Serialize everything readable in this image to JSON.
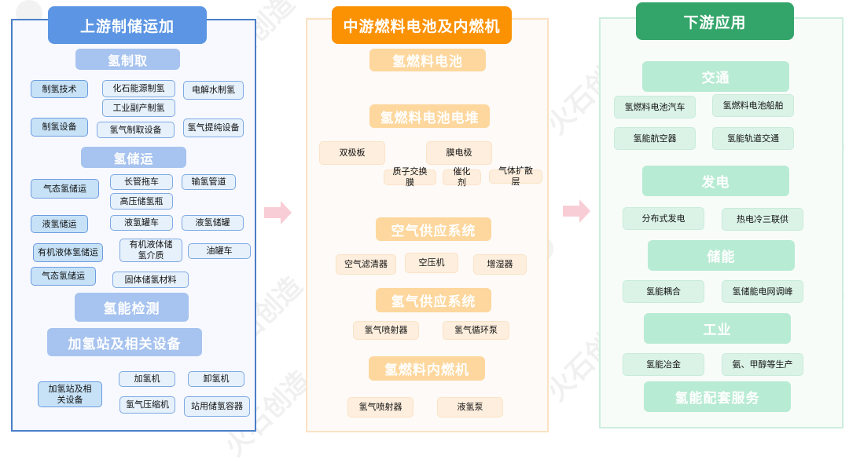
{
  "upstream": {
    "title": "上游制储运加",
    "sections": {
      "production": {
        "title": "氢制取",
        "categories": [
          "制氢技术",
          "制氢设备"
        ],
        "items": [
          "化石能源制氢",
          "电解水制氢",
          "工业副产制氢",
          "氢气制取设备",
          "氢气提纯设备"
        ]
      },
      "storage": {
        "title": "氢储运",
        "categories": [
          "气态氢储运",
          "液氢储运",
          "有机液体氢储运",
          "气态氢储运"
        ],
        "items": [
          "长管拖车",
          "输氢管道",
          "高压储氢瓶",
          "液氢罐车",
          "液氢储罐",
          "有机液体储氢介质",
          "油罐车",
          "固体储氢材料"
        ]
      },
      "detection": {
        "title": "氢能检测"
      },
      "station": {
        "title": "加氢站及相关设备",
        "categories": [
          "加氢站及相关设备"
        ],
        "items": [
          "加氢机",
          "卸氢机",
          "氢气压缩机",
          "站用储氢容器"
        ]
      }
    }
  },
  "midstream": {
    "title": "中游燃料电池及内燃机",
    "sections": {
      "fuel_cell": {
        "title": "氢燃料电池"
      },
      "stack": {
        "title": "氢燃料电池电堆",
        "items": [
          "双极板",
          "膜电极",
          "质子交换膜",
          "催化剂",
          "气体扩散层"
        ]
      },
      "air_supply": {
        "title": "空气供应系统",
        "items": [
          "空气滤清器",
          "空压机",
          "增湿器"
        ]
      },
      "hydrogen_supply": {
        "title": "氢气供应系统",
        "items": [
          "氢气喷射器",
          "氢气循环泵"
        ]
      },
      "ice": {
        "title": "氢燃料内燃机",
        "items": [
          "氢气喷射器",
          "液氢泵"
        ]
      }
    }
  },
  "downstream": {
    "title": "下游应用",
    "sections": {
      "transport": {
        "title": "交通",
        "items": [
          "氢燃料电池汽车",
          "氢燃料电池船舶",
          "氢能航空器",
          "氢能轨道交通"
        ]
      },
      "power": {
        "title": "发电",
        "items": [
          "分布式发电",
          "热电冷三联供"
        ]
      },
      "storage": {
        "title": "储能",
        "items": [
          "氢能耦合",
          "氢储能电网调峰"
        ]
      },
      "industry": {
        "title": "工业",
        "items": [
          "氢能冶金",
          "氨、甲醇等生产"
        ]
      },
      "services": {
        "title": "氢能配套服务"
      }
    }
  },
  "watermark": "火石创造",
  "colors": {
    "upstream_accent": "#5b95e3",
    "midstream_accent": "#fb9204",
    "downstream_accent": "#34a56a",
    "arrow": "#f9c8d0"
  },
  "icons": {
    "flow_arrow": "right-arrow-icon"
  }
}
